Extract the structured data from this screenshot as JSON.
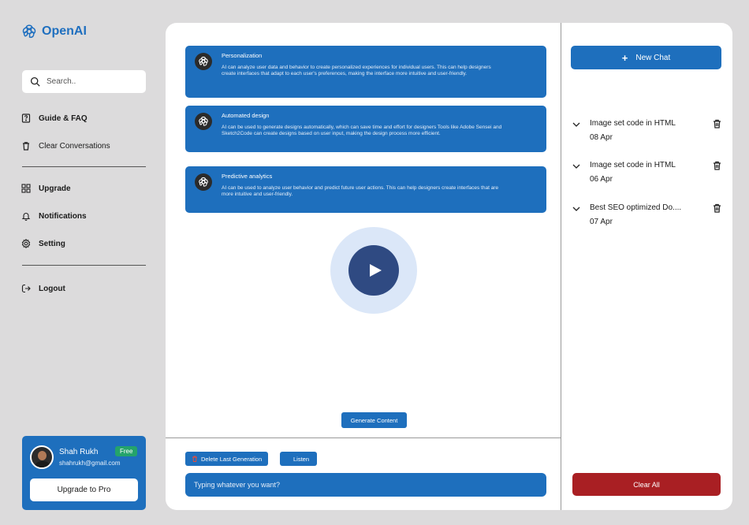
{
  "brand": {
    "name": "OpenAI",
    "color": "#1f6fbf"
  },
  "sidebar": {
    "search_placeholder": "Search..",
    "items": [
      {
        "label": "Guide & FAQ",
        "icon": "faq-icon"
      },
      {
        "label": "Clear Conversations",
        "icon": "trash-icon"
      },
      {
        "label": "Upgrade",
        "icon": "grid-icon"
      },
      {
        "label": "Notifications",
        "icon": "bell-icon"
      },
      {
        "label": "Setting",
        "icon": "gear-icon"
      },
      {
        "label": "Logout",
        "icon": "logout-icon"
      }
    ]
  },
  "profile": {
    "name": "Shah Rukh",
    "email": "shahrukh@gmail.com",
    "badge": "Free",
    "upgrade_label": "Upgrade to Pro"
  },
  "cards": [
    {
      "title": "Personalization",
      "body": "AI can analyze user data and behavior to create personalized experiences for individual users. This can help designers create interfaces that adapt to each user's preferences, making the interface  more intuitive and user-friendly."
    },
    {
      "title": "Automated design",
      "body": "AI can be used to generate designs automatically, which can save time and effort for designers Tools like Adobe Sensei and Sketch2Code can create designs based on user input, making the design process more efficient."
    },
    {
      "title": "Predictive analytics",
      "body": "AI can be used to analyze user behavior and predict future user actions. This can help designers create interfaces that are more intuitive and user-friendly."
    }
  ],
  "actions": {
    "generate": "Generate Content",
    "delete_last": "Delete Last Generation",
    "listen": "Listen",
    "input_placeholder": "Typing whatever you want?"
  },
  "history": {
    "new_chat": "New Chat",
    "items": [
      {
        "title": "Image set code in HTML",
        "date": "08 Apr"
      },
      {
        "title": "Image set code in HTML",
        "date": "06 Apr"
      },
      {
        "title": "Best SEO optimized Do....",
        "date": "07 Apr"
      }
    ],
    "clear_all": "Clear All"
  },
  "colors": {
    "primary": "#1e6fbd",
    "danger": "#a91f23",
    "badge": "#24a36b",
    "play": "#2f4a82"
  }
}
